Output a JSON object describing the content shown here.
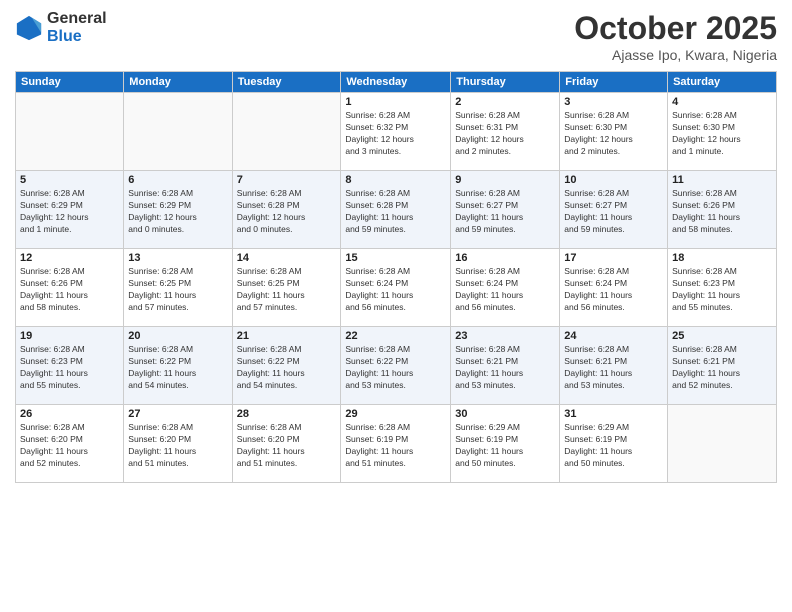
{
  "header": {
    "logo_line1": "General",
    "logo_line2": "Blue",
    "month": "October 2025",
    "location": "Ajasse Ipo, Kwara, Nigeria"
  },
  "days_of_week": [
    "Sunday",
    "Monday",
    "Tuesday",
    "Wednesday",
    "Thursday",
    "Friday",
    "Saturday"
  ],
  "weeks": [
    [
      {
        "num": "",
        "info": ""
      },
      {
        "num": "",
        "info": ""
      },
      {
        "num": "",
        "info": ""
      },
      {
        "num": "1",
        "info": "Sunrise: 6:28 AM\nSunset: 6:32 PM\nDaylight: 12 hours\nand 3 minutes."
      },
      {
        "num": "2",
        "info": "Sunrise: 6:28 AM\nSunset: 6:31 PM\nDaylight: 12 hours\nand 2 minutes."
      },
      {
        "num": "3",
        "info": "Sunrise: 6:28 AM\nSunset: 6:30 PM\nDaylight: 12 hours\nand 2 minutes."
      },
      {
        "num": "4",
        "info": "Sunrise: 6:28 AM\nSunset: 6:30 PM\nDaylight: 12 hours\nand 1 minute."
      }
    ],
    [
      {
        "num": "5",
        "info": "Sunrise: 6:28 AM\nSunset: 6:29 PM\nDaylight: 12 hours\nand 1 minute."
      },
      {
        "num": "6",
        "info": "Sunrise: 6:28 AM\nSunset: 6:29 PM\nDaylight: 12 hours\nand 0 minutes."
      },
      {
        "num": "7",
        "info": "Sunrise: 6:28 AM\nSunset: 6:28 PM\nDaylight: 12 hours\nand 0 minutes."
      },
      {
        "num": "8",
        "info": "Sunrise: 6:28 AM\nSunset: 6:28 PM\nDaylight: 11 hours\nand 59 minutes."
      },
      {
        "num": "9",
        "info": "Sunrise: 6:28 AM\nSunset: 6:27 PM\nDaylight: 11 hours\nand 59 minutes."
      },
      {
        "num": "10",
        "info": "Sunrise: 6:28 AM\nSunset: 6:27 PM\nDaylight: 11 hours\nand 59 minutes."
      },
      {
        "num": "11",
        "info": "Sunrise: 6:28 AM\nSunset: 6:26 PM\nDaylight: 11 hours\nand 58 minutes."
      }
    ],
    [
      {
        "num": "12",
        "info": "Sunrise: 6:28 AM\nSunset: 6:26 PM\nDaylight: 11 hours\nand 58 minutes."
      },
      {
        "num": "13",
        "info": "Sunrise: 6:28 AM\nSunset: 6:25 PM\nDaylight: 11 hours\nand 57 minutes."
      },
      {
        "num": "14",
        "info": "Sunrise: 6:28 AM\nSunset: 6:25 PM\nDaylight: 11 hours\nand 57 minutes."
      },
      {
        "num": "15",
        "info": "Sunrise: 6:28 AM\nSunset: 6:24 PM\nDaylight: 11 hours\nand 56 minutes."
      },
      {
        "num": "16",
        "info": "Sunrise: 6:28 AM\nSunset: 6:24 PM\nDaylight: 11 hours\nand 56 minutes."
      },
      {
        "num": "17",
        "info": "Sunrise: 6:28 AM\nSunset: 6:24 PM\nDaylight: 11 hours\nand 56 minutes."
      },
      {
        "num": "18",
        "info": "Sunrise: 6:28 AM\nSunset: 6:23 PM\nDaylight: 11 hours\nand 55 minutes."
      }
    ],
    [
      {
        "num": "19",
        "info": "Sunrise: 6:28 AM\nSunset: 6:23 PM\nDaylight: 11 hours\nand 55 minutes."
      },
      {
        "num": "20",
        "info": "Sunrise: 6:28 AM\nSunset: 6:22 PM\nDaylight: 11 hours\nand 54 minutes."
      },
      {
        "num": "21",
        "info": "Sunrise: 6:28 AM\nSunset: 6:22 PM\nDaylight: 11 hours\nand 54 minutes."
      },
      {
        "num": "22",
        "info": "Sunrise: 6:28 AM\nSunset: 6:22 PM\nDaylight: 11 hours\nand 53 minutes."
      },
      {
        "num": "23",
        "info": "Sunrise: 6:28 AM\nSunset: 6:21 PM\nDaylight: 11 hours\nand 53 minutes."
      },
      {
        "num": "24",
        "info": "Sunrise: 6:28 AM\nSunset: 6:21 PM\nDaylight: 11 hours\nand 53 minutes."
      },
      {
        "num": "25",
        "info": "Sunrise: 6:28 AM\nSunset: 6:21 PM\nDaylight: 11 hours\nand 52 minutes."
      }
    ],
    [
      {
        "num": "26",
        "info": "Sunrise: 6:28 AM\nSunset: 6:20 PM\nDaylight: 11 hours\nand 52 minutes."
      },
      {
        "num": "27",
        "info": "Sunrise: 6:28 AM\nSunset: 6:20 PM\nDaylight: 11 hours\nand 51 minutes."
      },
      {
        "num": "28",
        "info": "Sunrise: 6:28 AM\nSunset: 6:20 PM\nDaylight: 11 hours\nand 51 minutes."
      },
      {
        "num": "29",
        "info": "Sunrise: 6:28 AM\nSunset: 6:19 PM\nDaylight: 11 hours\nand 51 minutes."
      },
      {
        "num": "30",
        "info": "Sunrise: 6:29 AM\nSunset: 6:19 PM\nDaylight: 11 hours\nand 50 minutes."
      },
      {
        "num": "31",
        "info": "Sunrise: 6:29 AM\nSunset: 6:19 PM\nDaylight: 11 hours\nand 50 minutes."
      },
      {
        "num": "",
        "info": ""
      }
    ]
  ]
}
